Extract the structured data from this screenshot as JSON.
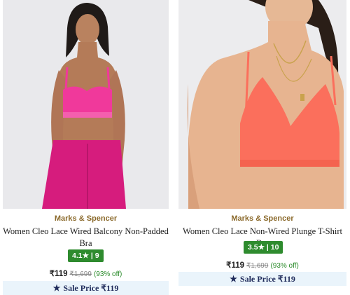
{
  "products": [
    {
      "brand": "Marks & Spencer",
      "title": "Women Cleo Lace Wired Balcony Non-Padded Bra",
      "rating": "4.1★ | 9",
      "price": "₹119",
      "mrp": "₹1,699",
      "discount": "(93% off)",
      "sale_label": "Sale Price ₹119",
      "colors": {
        "garment": "#f0399b",
        "pants": "#d61c7d",
        "background": "#e9e9ec"
      }
    },
    {
      "brand": "Marks & Spencer",
      "title": "Women Cleo Lace Non-Wired Plunge T-Shirt Bra",
      "rating": "3.5★ | 10",
      "price": "₹119",
      "mrp": "₹1,699",
      "discount": "(93% off)",
      "sale_label": "Sale Price ₹119",
      "colors": {
        "garment": "#fb6f5c",
        "background": "#ececee"
      }
    }
  ],
  "icons": {
    "sale": "star-icon"
  }
}
